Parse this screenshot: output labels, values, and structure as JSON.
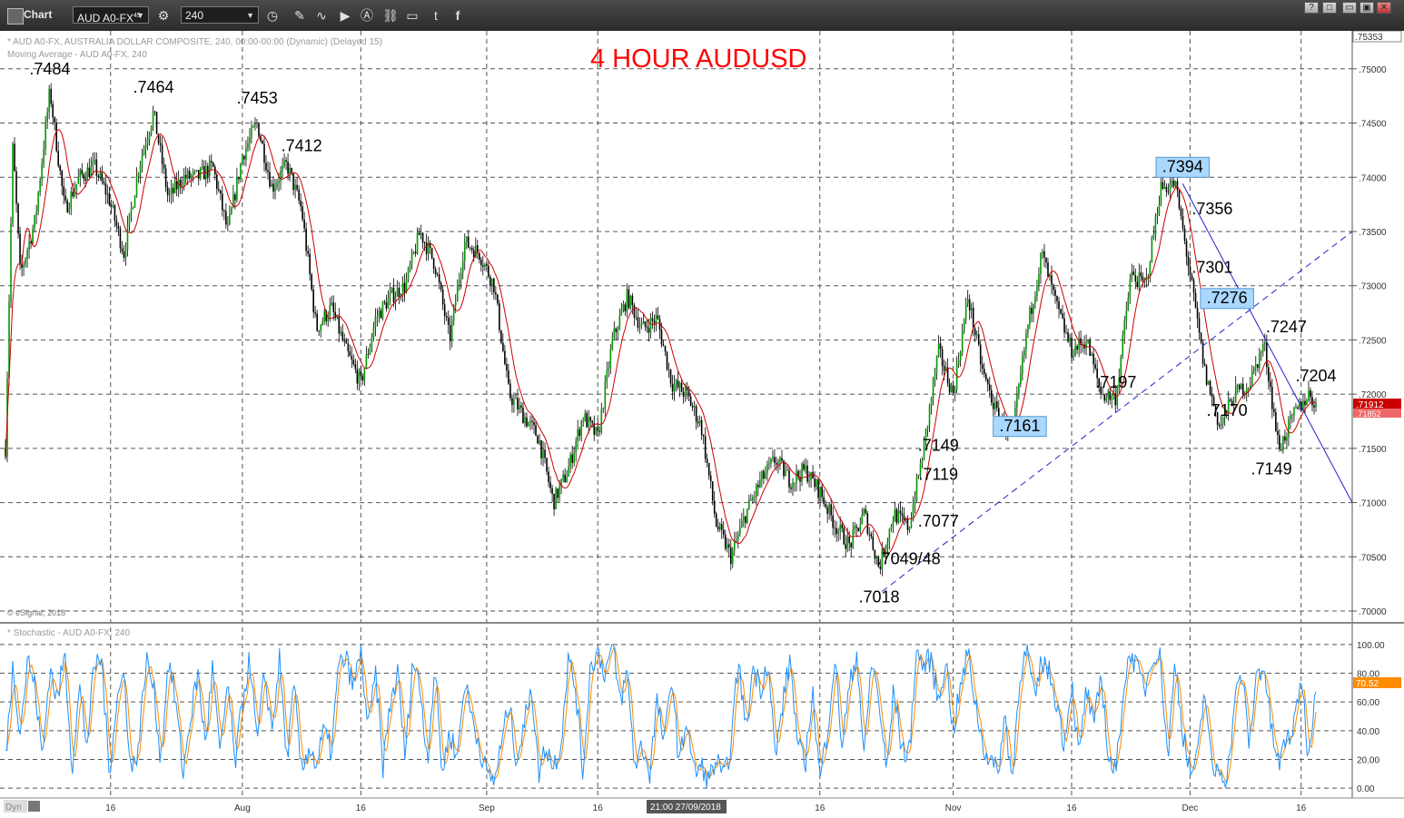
{
  "window": {
    "title": "Chart",
    "symbol": "AUD A0-FX",
    "symbol_superscript": "45",
    "interval": "240",
    "window_buttons": [
      "?",
      "□",
      "▭",
      "▣",
      "✕"
    ]
  },
  "price_pane": {
    "info_line1": "* AUD A0-FX, AUSTRALIA DOLLAR COMPOSITE, 240, 00:00-00:00 (Dynamic) (Delayed 15)",
    "info_line2": "Moving Average - AUD A0-FX, 240",
    "copyright": "© eSignal, 2018",
    "badge_last": ".71912",
    "badge_ma": ".71852"
  },
  "stoch_pane": {
    "info_line": "* Stochastic - AUD A0-FX, 240",
    "badge": "70.52"
  },
  "bottom_bar": {
    "mode": "Dyn",
    "crosshair_label": "21:00 27/09/2018"
  },
  "chart_data": {
    "type": "candlestick",
    "title": "4 HOUR AUDUSD",
    "y_ticks": [
      ".75000",
      ".74500",
      ".74000",
      ".73500",
      ".73000",
      ".72500",
      ".72000",
      ".71500",
      ".71000",
      ".70500",
      ".70000"
    ],
    "y_top_label": ".75353",
    "y_range": [
      0.6995,
      0.7535
    ],
    "x_ticks": [
      "16",
      "Aug",
      "16",
      "Sep",
      "16",
      "16",
      "Nov",
      "16",
      "Dec",
      "16"
    ],
    "stoch_ticks": [
      "100.00",
      "80.00",
      "60.00",
      "40.00",
      "20.00",
      "0.00"
    ],
    "stoch_range": [
      -5,
      105
    ],
    "colors": {
      "up": "#009900",
      "down": "#000000",
      "ma": "#cc0000",
      "stoch_k": "#1e90ff",
      "stoch_d": "#ff8c00",
      "trend": "#2222cc",
      "title": "#ff0000",
      "box": "#aad8ff"
    },
    "price_path": [
      [
        0,
        0.715
      ],
      [
        0.5,
        0.743
      ],
      [
        1,
        0.731
      ],
      [
        2,
        0.736
      ],
      [
        3,
        0.748
      ],
      [
        4,
        0.737
      ],
      [
        5,
        0.74
      ],
      [
        6,
        0.741
      ],
      [
        7,
        0.738
      ],
      [
        8,
        0.733
      ],
      [
        9,
        0.741
      ],
      [
        10,
        0.746
      ],
      [
        11,
        0.738
      ],
      [
        12,
        0.74
      ],
      [
        13,
        0.74
      ],
      [
        14,
        0.741
      ],
      [
        15,
        0.735
      ],
      [
        16,
        0.742
      ],
      [
        17,
        0.745
      ],
      [
        18,
        0.739
      ],
      [
        19,
        0.7412
      ],
      [
        20,
        0.737
      ],
      [
        21,
        0.726
      ],
      [
        22,
        0.728
      ],
      [
        23,
        0.724
      ],
      [
        24,
        0.721
      ],
      [
        25,
        0.727
      ],
      [
        26,
        0.729
      ],
      [
        27,
        0.73
      ],
      [
        28,
        0.735
      ],
      [
        29,
        0.732
      ],
      [
        30,
        0.725
      ],
      [
        31,
        0.734
      ],
      [
        32,
        0.733
      ],
      [
        33,
        0.73
      ],
      [
        34,
        0.72
      ],
      [
        35,
        0.718
      ],
      [
        36,
        0.716
      ],
      [
        37,
        0.71
      ],
      [
        38,
        0.713
      ],
      [
        39,
        0.718
      ],
      [
        40,
        0.716
      ],
      [
        41,
        0.725
      ],
      [
        42,
        0.729
      ],
      [
        43,
        0.726
      ],
      [
        44,
        0.727
      ],
      [
        45,
        0.721
      ],
      [
        46,
        0.72
      ],
      [
        47,
        0.717
      ],
      [
        48,
        0.708
      ],
      [
        49,
        0.705
      ],
      [
        50,
        0.709
      ],
      [
        51,
        0.712
      ],
      [
        52,
        0.714
      ],
      [
        53,
        0.712
      ],
      [
        54,
        0.713
      ],
      [
        55,
        0.711
      ],
      [
        56,
        0.708
      ],
      [
        57,
        0.706
      ],
      [
        58,
        0.709
      ],
      [
        59,
        0.704
      ],
      [
        60,
        0.709
      ],
      [
        61,
        0.7077
      ],
      [
        62,
        0.7149
      ],
      [
        63,
        0.724
      ],
      [
        64,
        0.72
      ],
      [
        65,
        0.729
      ],
      [
        66,
        0.722
      ],
      [
        67,
        0.718
      ],
      [
        68,
        0.7161
      ],
      [
        69,
        0.726
      ],
      [
        70,
        0.733
      ],
      [
        71,
        0.728
      ],
      [
        72,
        0.724
      ],
      [
        73,
        0.725
      ],
      [
        74,
        0.72
      ],
      [
        75,
        0.7197
      ],
      [
        76,
        0.731
      ],
      [
        77,
        0.73
      ],
      [
        78,
        0.739
      ],
      [
        79,
        0.7394
      ],
      [
        80,
        0.731
      ],
      [
        81,
        0.722
      ],
      [
        82,
        0.717
      ],
      [
        83,
        0.72
      ],
      [
        84,
        0.721
      ],
      [
        85,
        0.7247
      ],
      [
        86,
        0.7149
      ],
      [
        87,
        0.718
      ],
      [
        88,
        0.72
      ],
      [
        88.5,
        0.7191
      ]
    ],
    "stoch_path": [
      [
        0,
        20
      ],
      [
        0.5,
        85
      ],
      [
        1,
        40
      ],
      [
        1.5,
        90
      ],
      [
        2,
        70
      ],
      [
        2.5,
        20
      ],
      [
        3,
        85
      ],
      [
        3.5,
        60
      ],
      [
        4,
        95
      ],
      [
        4.5,
        15
      ],
      [
        5,
        70
      ],
      [
        5.5,
        30
      ],
      [
        6,
        85
      ],
      [
        6.5,
        90
      ],
      [
        7,
        10
      ],
      [
        7.5,
        60
      ],
      [
        8,
        80
      ],
      [
        8.5,
        10
      ],
      [
        9,
        30
      ],
      [
        9.5,
        90
      ],
      [
        10,
        70
      ],
      [
        10.5,
        20
      ],
      [
        11,
        90
      ],
      [
        11.5,
        60
      ],
      [
        12,
        10
      ],
      [
        12.5,
        50
      ],
      [
        13,
        80
      ],
      [
        13.5,
        30
      ],
      [
        14,
        85
      ],
      [
        14.5,
        20
      ],
      [
        15,
        75
      ],
      [
        15.5,
        15
      ],
      [
        16,
        60
      ],
      [
        16.5,
        90
      ],
      [
        17,
        30
      ],
      [
        17.5,
        80
      ],
      [
        18,
        40
      ],
      [
        18.5,
        90
      ],
      [
        19,
        20
      ],
      [
        19.5,
        70
      ],
      [
        20,
        10
      ],
      [
        20.5,
        30
      ],
      [
        21,
        15
      ],
      [
        21.5,
        40
      ],
      [
        22,
        25
      ],
      [
        22.5,
        85
      ],
      [
        23,
        90
      ],
      [
        23.5,
        70
      ],
      [
        24,
        95
      ],
      [
        24.5,
        40
      ],
      [
        25,
        80
      ],
      [
        25.5,
        15
      ],
      [
        26,
        60
      ],
      [
        26.5,
        80
      ],
      [
        27,
        20
      ],
      [
        27.5,
        90
      ],
      [
        28,
        70
      ],
      [
        28.5,
        20
      ],
      [
        29,
        85
      ],
      [
        29.5,
        10
      ],
      [
        30,
        40
      ],
      [
        30.5,
        20
      ],
      [
        31,
        75
      ],
      [
        31.5,
        50
      ],
      [
        32,
        30
      ],
      [
        32.5,
        10
      ],
      [
        33,
        5
      ],
      [
        33.5,
        30
      ],
      [
        34,
        60
      ],
      [
        34.5,
        20
      ],
      [
        35,
        40
      ],
      [
        35.5,
        75
      ],
      [
        36,
        10
      ],
      [
        36.5,
        30
      ],
      [
        37,
        15
      ],
      [
        37.5,
        30
      ],
      [
        38,
        90
      ],
      [
        38.5,
        70
      ],
      [
        39,
        10
      ],
      [
        39.5,
        85
      ],
      [
        40,
        95
      ],
      [
        40.5,
        80
      ],
      [
        41,
        100
      ],
      [
        41.5,
        60
      ],
      [
        42,
        80
      ],
      [
        42.5,
        15
      ],
      [
        43,
        30
      ],
      [
        43.5,
        10
      ],
      [
        44,
        60
      ],
      [
        44.5,
        30
      ],
      [
        45,
        80
      ],
      [
        45.5,
        15
      ],
      [
        46,
        50
      ],
      [
        46.5,
        10
      ],
      [
        47,
        15
      ],
      [
        47.5,
        5
      ],
      [
        48,
        20
      ],
      [
        48.5,
        5
      ],
      [
        49,
        30
      ],
      [
        49.5,
        90
      ],
      [
        50,
        40
      ],
      [
        50.5,
        85
      ],
      [
        51,
        70
      ],
      [
        51.5,
        90
      ],
      [
        52,
        20
      ],
      [
        52.5,
        60
      ],
      [
        53,
        90
      ],
      [
        53.5,
        30
      ],
      [
        54,
        15
      ],
      [
        54.5,
        70
      ],
      [
        55,
        5
      ],
      [
        55.5,
        40
      ],
      [
        56,
        90
      ],
      [
        56.5,
        30
      ],
      [
        57,
        70
      ],
      [
        57.5,
        95
      ],
      [
        58,
        20
      ],
      [
        58.5,
        90
      ],
      [
        59,
        60
      ],
      [
        59.5,
        10
      ],
      [
        60,
        70
      ],
      [
        60.5,
        30
      ],
      [
        61,
        20
      ],
      [
        61.5,
        95
      ],
      [
        62,
        85
      ],
      [
        62.5,
        90
      ],
      [
        63,
        60
      ],
      [
        63.5,
        90
      ],
      [
        64,
        40
      ],
      [
        64.5,
        70
      ],
      [
        65,
        95
      ],
      [
        65.5,
        60
      ],
      [
        66,
        30
      ],
      [
        66.5,
        20
      ],
      [
        67,
        10
      ],
      [
        67.5,
        50
      ],
      [
        68,
        5
      ],
      [
        68.5,
        80
      ],
      [
        69,
        95
      ],
      [
        69.5,
        60
      ],
      [
        70,
        90
      ],
      [
        70.5,
        80
      ],
      [
        71,
        60
      ],
      [
        71.5,
        30
      ],
      [
        72,
        75
      ],
      [
        72.5,
        20
      ],
      [
        73,
        70
      ],
      [
        73.5,
        40
      ],
      [
        74,
        80
      ],
      [
        74.5,
        20
      ],
      [
        75,
        10
      ],
      [
        75.5,
        70
      ],
      [
        76,
        95
      ],
      [
        76.5,
        80
      ],
      [
        77,
        70
      ],
      [
        77.5,
        95
      ],
      [
        78,
        90
      ],
      [
        78.5,
        20
      ],
      [
        79,
        90
      ],
      [
        79.5,
        40
      ],
      [
        80,
        10
      ],
      [
        80.5,
        20
      ],
      [
        81,
        70
      ],
      [
        81.5,
        10
      ],
      [
        82,
        15
      ],
      [
        82.5,
        5
      ],
      [
        83,
        60
      ],
      [
        83.5,
        80
      ],
      [
        84,
        30
      ],
      [
        84.5,
        80
      ],
      [
        85,
        85
      ],
      [
        85.5,
        40
      ],
      [
        86,
        15
      ],
      [
        86.5,
        35
      ],
      [
        87,
        40
      ],
      [
        87.5,
        80
      ],
      [
        88,
        20
      ],
      [
        88.5,
        75
      ]
    ],
    "annotations": [
      {
        "text": ".7484",
        "i": 3,
        "p": 0.7495,
        "box": false
      },
      {
        "text": ".7464",
        "i": 10,
        "p": 0.7478,
        "box": false
      },
      {
        "text": ".7453",
        "i": 17,
        "p": 0.7468,
        "box": false
      },
      {
        "text": ".7412",
        "i": 20,
        "p": 0.7424,
        "box": false
      },
      {
        "text": ".7394",
        "i": 79.5,
        "p": 0.7405,
        "box": true
      },
      {
        "text": ".7356",
        "i": 81.5,
        "p": 0.7366,
        "box": false
      },
      {
        "text": ".7301",
        "i": 81.5,
        "p": 0.7312,
        "box": false
      },
      {
        "text": ".7276",
        "i": 82.5,
        "p": 0.7284,
        "box": true
      },
      {
        "text": ".7247",
        "i": 86.5,
        "p": 0.7257,
        "box": false
      },
      {
        "text": ".7204",
        "i": 88.5,
        "p": 0.7212,
        "box": false
      },
      {
        "text": ".7197",
        "i": 75,
        "p": 0.7206,
        "box": false
      },
      {
        "text": ".7170",
        "i": 82.5,
        "p": 0.718,
        "box": false
      },
      {
        "text": ".7149",
        "i": 85.5,
        "p": 0.7126,
        "box": false
      },
      {
        "text": ".7161",
        "i": 68.5,
        "p": 0.7166,
        "box": true
      },
      {
        "text": ".7149",
        "i": 63,
        "p": 0.7148,
        "box": false
      },
      {
        "text": ".7119",
        "i": 63,
        "p": 0.7121,
        "box": false
      },
      {
        "text": ".7077",
        "i": 63,
        "p": 0.7078,
        "box": false
      },
      {
        "text": ".7049/48",
        "i": 61,
        "p": 0.7043,
        "box": false
      },
      {
        "text": ".7018",
        "i": 59,
        "p": 0.7008,
        "box": false
      }
    ],
    "trendlines": [
      {
        "from": [
          59.2,
          0.7018
        ],
        "to": [
          95,
          0.735
        ],
        "style": "dashed"
      },
      {
        "from": [
          79.5,
          0.7394
        ],
        "to": [
          95,
          0.71
        ],
        "style": "solid"
      }
    ]
  }
}
